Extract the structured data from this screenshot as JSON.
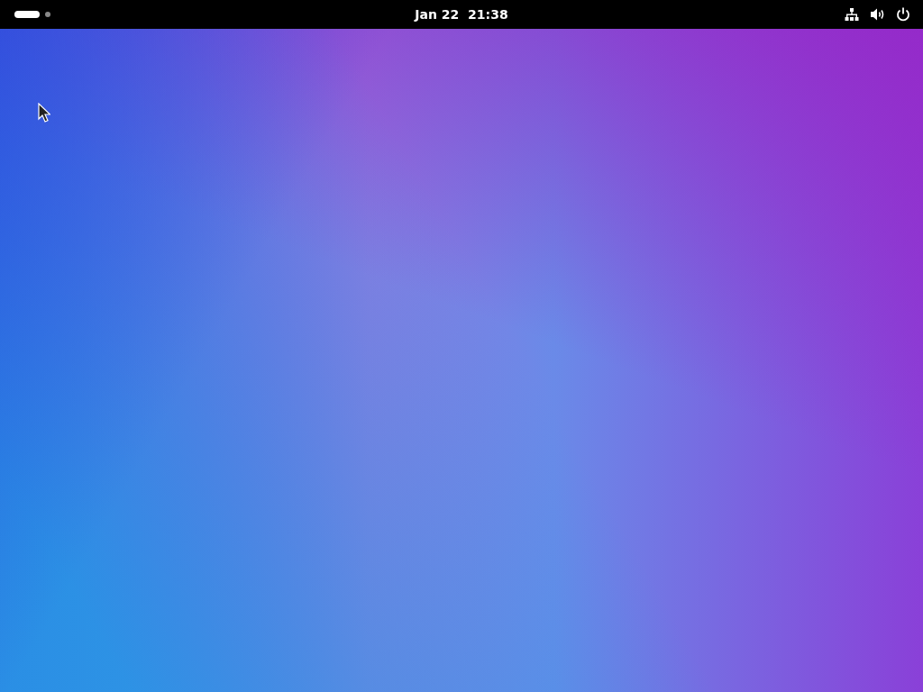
{
  "top_bar": {
    "workspaces": [
      {
        "selected": true
      },
      {
        "selected": false
      }
    ],
    "clock": "Jan 22  21:38"
  }
}
